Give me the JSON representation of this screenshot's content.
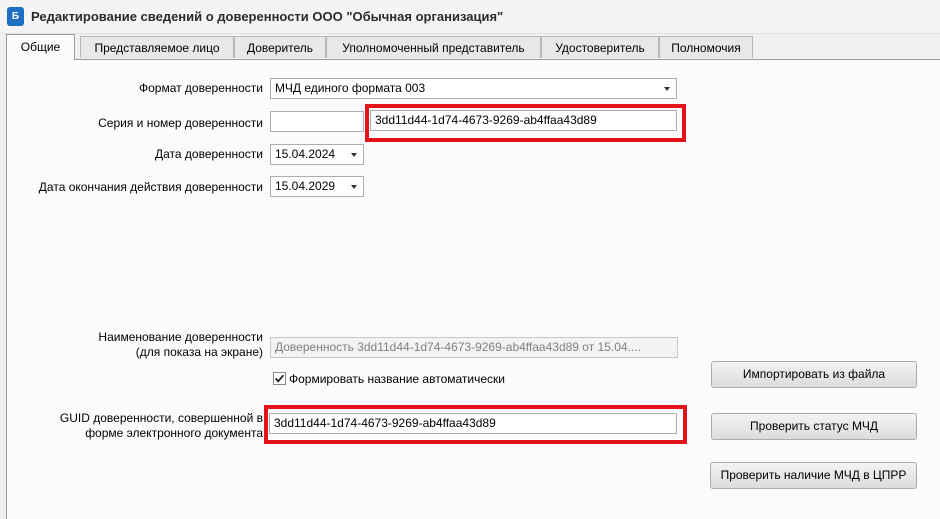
{
  "window": {
    "title": "Редактирование сведений о доверенности ООО \"Обычная организация\"",
    "icon_label": "Б"
  },
  "tabs": [
    {
      "label": "Общие",
      "active": true
    },
    {
      "label": "Представляемое лицо"
    },
    {
      "label": "Доверитель"
    },
    {
      "label": "Уполномоченный представитель"
    },
    {
      "label": "Удостоверитель"
    },
    {
      "label": "Полномочия"
    }
  ],
  "form": {
    "format_label": "Формат доверенности",
    "format_value": "МЧД единого формата 003",
    "series_label": "Серия и номер доверенности",
    "series_value": "",
    "number_value": "3dd11d44-1d74-4673-9269-ab4ffaa43d89",
    "date_label": "Дата доверенности",
    "date_value": "15.04.2024",
    "end_date_label": "Дата окончания действия доверенности",
    "end_date_value": "15.04.2029",
    "name_label_line1": "Наименование доверенности",
    "name_label_line2": "(для показа на экране)",
    "name_value": "Доверенность 3dd11d44-1d74-4673-9269-ab4ffaa43d89 от 15.04....",
    "auto_name_label": "Формировать название автоматически",
    "auto_name_checked": true,
    "guid_label_line1": "GUID доверенности, совершенной в",
    "guid_label_line2": "форме электронного документа",
    "guid_value": "3dd11d44-1d74-4673-9269-ab4ffaa43d89"
  },
  "buttons": {
    "import": "Импортировать из файла",
    "check_status": "Проверить статус МЧД",
    "check_cprr": "Проверить наличие МЧД в ЦПРР"
  },
  "colors": {
    "highlight": "#e3131b",
    "icon_blue": "#1e6fc4"
  }
}
